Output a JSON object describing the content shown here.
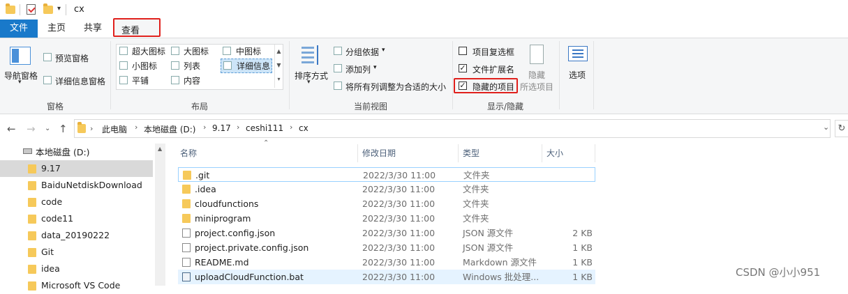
{
  "titlebar": {
    "title": "cx"
  },
  "tabs": {
    "file": "文件",
    "home": "主页",
    "share": "共享",
    "view": "查看"
  },
  "ribbon": {
    "panes": {
      "nav_pane": "导航窗格",
      "preview_pane": "预览窗格",
      "details_pane": "详细信息窗格",
      "group_label": "窗格"
    },
    "layout": {
      "extra_large": "超大图标",
      "large": "大图标",
      "medium": "中图标",
      "small": "小图标",
      "list": "列表",
      "details": "详细信息",
      "tiles": "平铺",
      "content": "内容",
      "group_label": "布局"
    },
    "current_view": {
      "sort_by": "排序方式",
      "group_by": "分组依据",
      "add_column": "添加列",
      "fit_columns": "将所有列调整为合适的大小",
      "group_label": "当前视图"
    },
    "show_hide": {
      "item_checkboxes": "项目复选框",
      "file_extensions": "文件扩展名",
      "hidden_items": "隐藏的项目",
      "hide_selected_line1": "隐藏",
      "hide_selected_line2": "所选项目",
      "options": "选项",
      "group_label": "显示/隐藏",
      "item_checkboxes_checked": false,
      "file_extensions_checked": true,
      "hidden_items_checked": true
    }
  },
  "address": {
    "crumbs": [
      "此电脑",
      "本地磁盘 (D:)",
      "9.17",
      "ceshi111",
      "cx"
    ]
  },
  "nav": {
    "drive": "本地磁盘 (D:)",
    "items": [
      "9.17",
      "BaiduNetdiskDownload",
      "code",
      "code11",
      "data_20190222",
      "Git",
      "idea",
      "Microsoft VS Code"
    ]
  },
  "columns": {
    "name": "名称",
    "date": "修改日期",
    "type": "类型",
    "size": "大小"
  },
  "files": [
    {
      "name": ".git",
      "date": "2022/3/30 11:00",
      "type": "文件夹",
      "size": "",
      "icon": "folder-icon"
    },
    {
      "name": ".idea",
      "date": "2022/3/30 11:00",
      "type": "文件夹",
      "size": "",
      "icon": "folder-icon"
    },
    {
      "name": "cloudfunctions",
      "date": "2022/3/30 11:00",
      "type": "文件夹",
      "size": "",
      "icon": "folder-icon"
    },
    {
      "name": "miniprogram",
      "date": "2022/3/30 11:00",
      "type": "文件夹",
      "size": "",
      "icon": "folder-icon"
    },
    {
      "name": "project.config.json",
      "date": "2022/3/30 11:00",
      "type": "JSON 源文件",
      "size": "2 KB",
      "icon": "file-icon"
    },
    {
      "name": "project.private.config.json",
      "date": "2022/3/30 11:00",
      "type": "JSON 源文件",
      "size": "1 KB",
      "icon": "file-icon"
    },
    {
      "name": "README.md",
      "date": "2022/3/30 11:00",
      "type": "Markdown 源文件",
      "size": "1 KB",
      "icon": "file-icon"
    },
    {
      "name": "uploadCloudFunction.bat",
      "date": "2022/3/30 11:00",
      "type": "Windows 批处理...",
      "size": "1 KB",
      "icon": "gear-file-icon"
    }
  ],
  "watermark": "CSDN @小小951",
  "colors": {
    "accent": "#1979ca",
    "highlight": "#e0201c",
    "selection": "#cce4f7",
    "folder": "#f6c95a"
  }
}
